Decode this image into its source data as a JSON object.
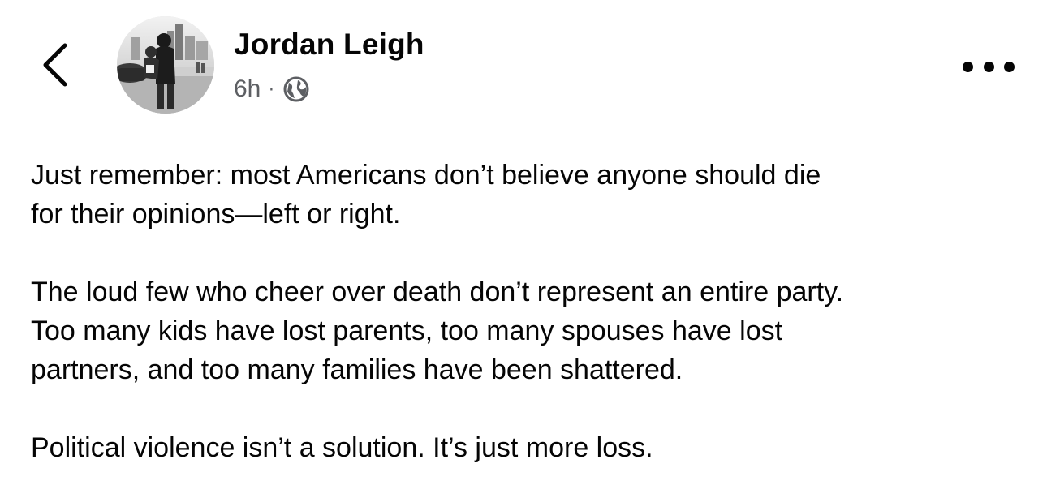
{
  "post": {
    "author": {
      "name": "Jordan Leigh",
      "avatar_icon": "profile-photo"
    },
    "timestamp": "6h",
    "separator": "·",
    "audience_icon": "globe-icon",
    "paragraphs": [
      "Just remember: most Americans don’t believe anyone should die\nfor their opinions—left or right.",
      "The loud few who cheer over death don’t represent an entire party.\nToo many kids have lost parents, too many spouses have lost\npartners, and too many families have been shattered.",
      "Political violence isn’t a solution. It’s just more loss."
    ]
  },
  "header": {
    "back_icon": "chevron-left-icon",
    "more_icon": "more-horizontal-icon"
  },
  "colors": {
    "text_primary": "#050505",
    "text_secondary": "#5d5f63",
    "background": "#ffffff"
  }
}
